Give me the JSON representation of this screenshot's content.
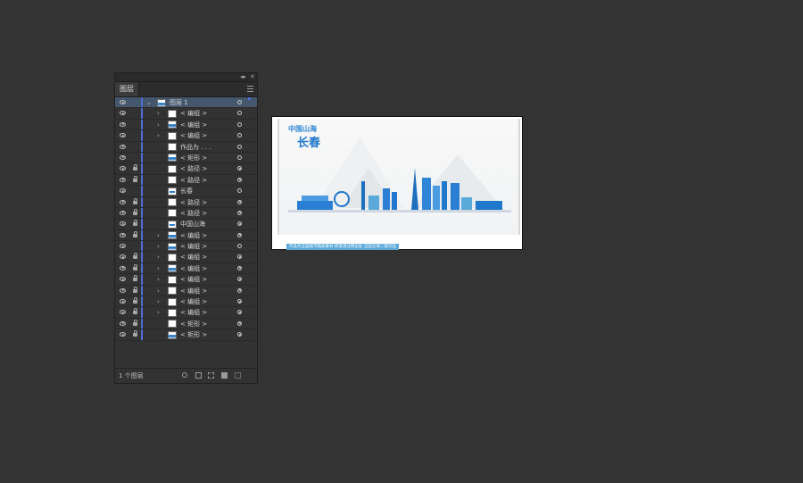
{
  "panel": {
    "tab_label": "图层",
    "collapse_glyph": "◂▸",
    "close_glyph": "✕",
    "layer_count_text": "1 个图层",
    "accent_color": "#4f6ed8",
    "selected_row_color": "#45576d"
  },
  "layers": [
    {
      "name": "图层 1",
      "level": 0,
      "chevron": "⌄",
      "visible": true,
      "locked": false,
      "thumb": "img",
      "selected": true
    },
    {
      "name": "< 编组 >",
      "level": 1,
      "chevron": "›",
      "visible": true,
      "locked": false,
      "thumb": "blank"
    },
    {
      "name": "< 编组 >",
      "level": 1,
      "chevron": "›",
      "visible": true,
      "locked": false,
      "thumb": "img"
    },
    {
      "name": "< 编组 >",
      "level": 1,
      "chevron": "›",
      "visible": true,
      "locked": false,
      "thumb": "blank"
    },
    {
      "name": "作品为 . . .",
      "level": 1,
      "chevron": "",
      "visible": true,
      "locked": false,
      "thumb": "blank"
    },
    {
      "name": "< 矩形 >",
      "level": 1,
      "chevron": "",
      "visible": true,
      "locked": false,
      "thumb": "img"
    },
    {
      "name": "< 路径 >",
      "level": 1,
      "chevron": "",
      "visible": true,
      "locked": true,
      "thumb": "blank"
    },
    {
      "name": "< 路径 >",
      "level": 1,
      "chevron": "",
      "visible": true,
      "locked": true,
      "thumb": "blank"
    },
    {
      "name": "长春",
      "level": 1,
      "chevron": "",
      "visible": true,
      "locked": false,
      "thumb": "text"
    },
    {
      "name": "< 路径 >",
      "level": 1,
      "chevron": "",
      "visible": true,
      "locked": true,
      "thumb": "blank"
    },
    {
      "name": "< 路径 >",
      "level": 1,
      "chevron": "",
      "visible": true,
      "locked": true,
      "thumb": "blank"
    },
    {
      "name": "中国山海",
      "level": 1,
      "chevron": "",
      "visible": true,
      "locked": true,
      "thumb": "text"
    },
    {
      "name": "< 编组 >",
      "level": 1,
      "chevron": "›",
      "visible": true,
      "locked": true,
      "thumb": "img"
    },
    {
      "name": "< 编组 >",
      "level": 1,
      "chevron": "›",
      "visible": true,
      "locked": false,
      "thumb": "img"
    },
    {
      "name": "< 编组 >",
      "level": 1,
      "chevron": "›",
      "visible": true,
      "locked": true,
      "thumb": "blank"
    },
    {
      "name": "< 编组 >",
      "level": 1,
      "chevron": "›",
      "visible": true,
      "locked": true,
      "thumb": "img"
    },
    {
      "name": "< 编组 >",
      "level": 1,
      "chevron": "›",
      "visible": true,
      "locked": true,
      "thumb": "blank"
    },
    {
      "name": "< 编组 >",
      "level": 1,
      "chevron": "›",
      "visible": true,
      "locked": true,
      "thumb": "blank"
    },
    {
      "name": "< 编组 >",
      "level": 1,
      "chevron": "›",
      "visible": true,
      "locked": true,
      "thumb": "blank"
    },
    {
      "name": "< 编组 >",
      "level": 1,
      "chevron": "›",
      "visible": true,
      "locked": true,
      "thumb": "blank"
    },
    {
      "name": "< 矩形 >",
      "level": 1,
      "chevron": "",
      "visible": true,
      "locked": true,
      "thumb": "blank"
    },
    {
      "name": "< 矩形 >",
      "level": 1,
      "chevron": "",
      "visible": true,
      "locked": true,
      "thumb": "img"
    }
  ],
  "artboard": {
    "title_small": "中国山海",
    "title_big": "长春",
    "caption": "作品为全国城市图表素材 转发请注明出处 全国全球二套作品",
    "primary_color": "#1f78cc"
  }
}
